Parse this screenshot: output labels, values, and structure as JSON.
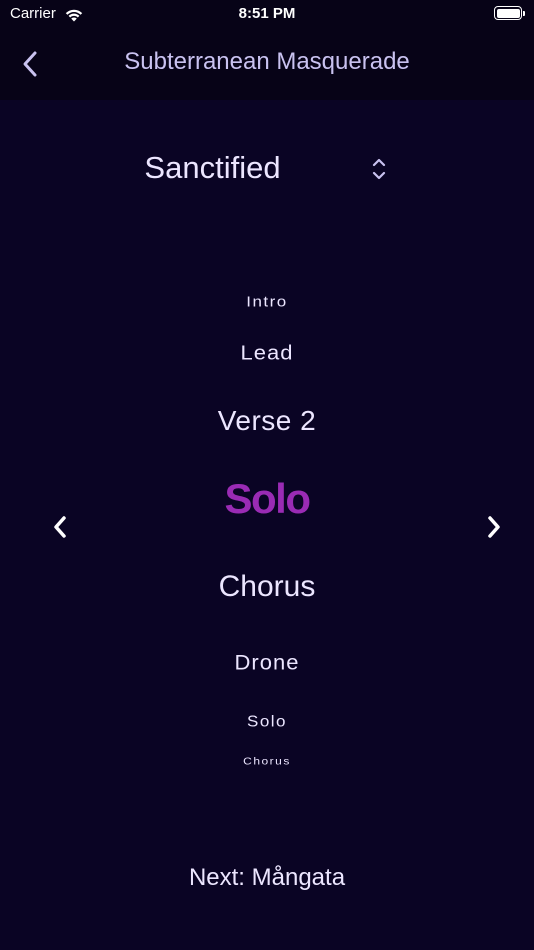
{
  "status_bar": {
    "carrier": "Carrier",
    "time": "8:51 PM"
  },
  "nav": {
    "title": "Subterranean Masquerade",
    "back_icon": "chevron-left-icon"
  },
  "preset": {
    "label": "Sanctified",
    "icon": "chevron-up-down-icon"
  },
  "sections": [
    {
      "label": "Intro"
    },
    {
      "label": "Lead"
    },
    {
      "label": "Verse 2"
    },
    {
      "label": "Solo",
      "selected": true
    },
    {
      "label": "Chorus"
    },
    {
      "label": "Drone"
    },
    {
      "label": "Solo"
    },
    {
      "label": "Chorus"
    }
  ],
  "navigation": {
    "prev_icon": "chevron-left-icon",
    "next_icon": "chevron-right-icon"
  },
  "next_song": "Next: Mångata",
  "colors": {
    "background": "#0a0424",
    "bar_background": "#070317",
    "accent": "#9a2bb4",
    "text": "#ece6ff",
    "title_text": "#c9c2f0"
  }
}
